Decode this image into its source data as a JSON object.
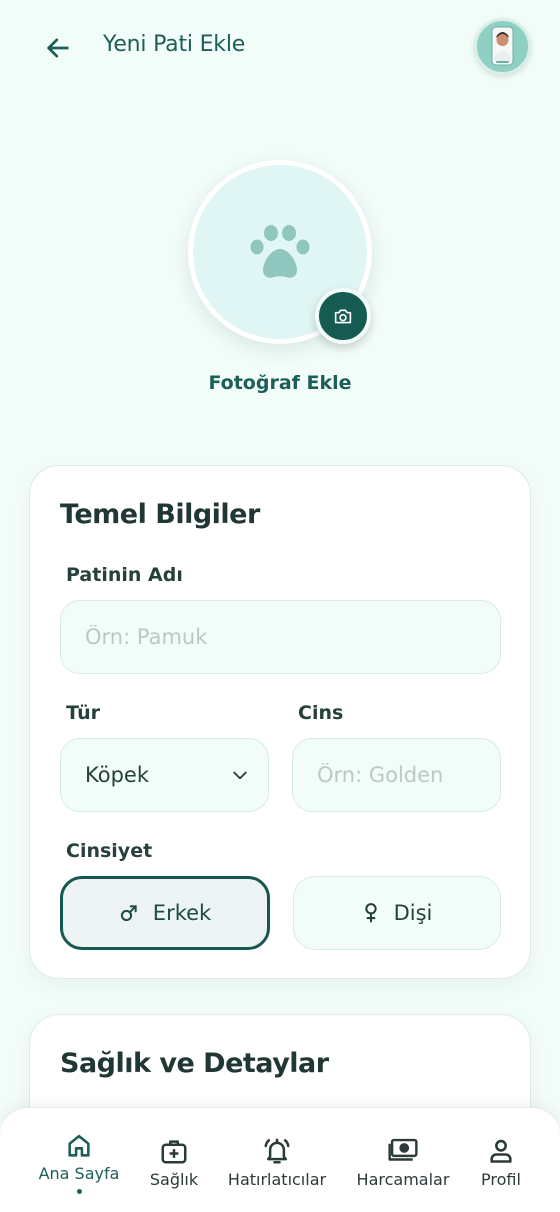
{
  "header": {
    "title": "Yeni Pati Ekle",
    "back_icon": "arrow-left-icon",
    "avatar_icon": "user-avatar"
  },
  "photo": {
    "placeholder_icon": "paw-icon",
    "camera_icon": "camera-icon",
    "add_label": "Fotoğraf Ekle"
  },
  "basic_info": {
    "title": "Temel Bilgiler",
    "name_label": "Patinin Adı",
    "name_placeholder": "Örn: Pamuk",
    "name_value": "",
    "type_label": "Tür",
    "type_value": "Köpek",
    "breed_label": "Cins",
    "breed_placeholder": "Örn: Golden",
    "breed_value": "",
    "gender_label": "Cinsiyet",
    "gender_options": [
      {
        "label": "Erkek",
        "icon": "male-icon",
        "selected": true
      },
      {
        "label": "Dişi",
        "icon": "female-icon",
        "selected": false
      }
    ]
  },
  "health": {
    "title": "Sağlık ve Detaylar"
  },
  "nav": {
    "items": [
      {
        "label": "Ana Sayfa",
        "icon": "home-icon",
        "active": true
      },
      {
        "label": "Sağlık",
        "icon": "medical-kit-icon",
        "active": false
      },
      {
        "label": "Hatırlatıcılar",
        "icon": "bell-icon",
        "active": false
      },
      {
        "label": "Harcamalar",
        "icon": "money-icon",
        "active": false
      },
      {
        "label": "Profil",
        "icon": "person-icon",
        "active": false
      }
    ]
  },
  "colors": {
    "primary": "#155b52",
    "background": "#f2fcf9",
    "card": "#ffffff",
    "photo_bg": "#dff6f4",
    "paw": "#8fc6bd"
  }
}
